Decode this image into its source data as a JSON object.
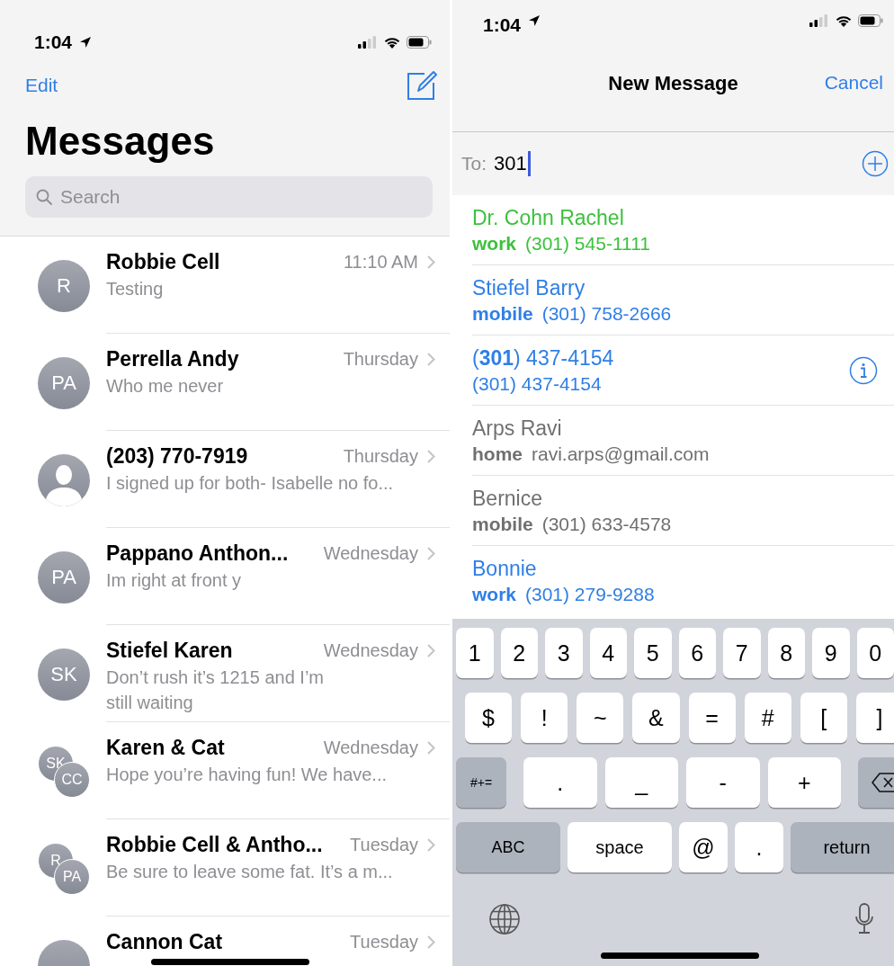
{
  "inbox": {
    "status_bar": {
      "time": "1:04"
    },
    "nav": {
      "edit": "Edit"
    },
    "title": "Messages",
    "search": {
      "placeholder": "Search"
    },
    "conversations": [
      {
        "name": "Robbie Cell",
        "time": "11:10 AM",
        "preview": "Testing",
        "avatar": {
          "kind": "initials",
          "initials": [
            "R"
          ]
        }
      },
      {
        "name": "Perrella Andy",
        "time": "Thursday",
        "preview": "Who me never",
        "avatar": {
          "kind": "initials",
          "initials": [
            "PA"
          ]
        }
      },
      {
        "name": "(203) 770-7919",
        "time": "Thursday",
        "preview": "I signed up for both- Isabelle no fo...",
        "avatar": {
          "kind": "silhouette"
        }
      },
      {
        "name": "Pappano Anthon...",
        "time": "Wednesday",
        "preview": "Im right at front y",
        "avatar": {
          "kind": "initials",
          "initials": [
            "PA"
          ]
        }
      },
      {
        "name": "Stiefel Karen",
        "time": "Wednesday",
        "preview": "Don’t rush it’s 1215 and I’m\nstill waiting",
        "avatar": {
          "kind": "initials",
          "initials": [
            "SK"
          ]
        }
      },
      {
        "name": "Karen & Cat",
        "time": "Wednesday",
        "preview": "Hope you’re having fun! We have...",
        "avatar": {
          "kind": "group",
          "initials": [
            "SK",
            "CC"
          ]
        }
      },
      {
        "name": "Robbie Cell & Antho...",
        "time": "Tuesday",
        "preview": "Be sure to leave some fat. It’s a m...",
        "avatar": {
          "kind": "group",
          "initials": [
            "R",
            "PA"
          ]
        }
      },
      {
        "name": "Cannon Cat",
        "time": "Tuesday",
        "avatar": {
          "kind": "blank"
        }
      }
    ]
  },
  "compose": {
    "status_bar": {
      "time": "1:04"
    },
    "nav": {
      "title": "New Message",
      "cancel": "Cancel"
    },
    "to_field": {
      "label": "To:",
      "value": "301"
    },
    "suggestions": [
      {
        "name": "Dr. Cohn Rachel",
        "label": "work",
        "detail": "(301) 545-1111",
        "color": "#3cc13c",
        "info": false
      },
      {
        "name": "Stiefel Barry",
        "label": "mobile",
        "detail": "(301) 758-2666",
        "color": "#2f7fe6",
        "info": false
      },
      {
        "name": "(**301**) 437-4154",
        "detail": "(301) 437-4154",
        "color": "#2f7fe6",
        "info": true
      },
      {
        "name": "Arps Ravi",
        "label": "home",
        "detail": "ravi.arps@gmail.com",
        "color": "#707070",
        "info": false
      },
      {
        "name": "Bernice",
        "label": "mobile",
        "detail": "(301) 633-4578",
        "color": "#707070",
        "info": false
      },
      {
        "name": "Bonnie",
        "label": "work",
        "detail": "(301) 279-9288",
        "color": "#2f7fe6",
        "info": false
      }
    ],
    "keyboard": {
      "rows": [
        {
          "keys": [
            {
              "kind": "char",
              "label": "1"
            },
            {
              "kind": "char",
              "label": "2"
            },
            {
              "kind": "char",
              "label": "3"
            },
            {
              "kind": "char",
              "label": "4"
            },
            {
              "kind": "char",
              "label": "5"
            },
            {
              "kind": "char",
              "label": "6"
            },
            {
              "kind": "char",
              "label": "7"
            },
            {
              "kind": "char",
              "label": "8"
            },
            {
              "kind": "char",
              "label": "9"
            },
            {
              "kind": "char",
              "label": "0"
            }
          ]
        },
        {
          "keys": [
            {
              "kind": "char",
              "label": "$"
            },
            {
              "kind": "char",
              "label": "!"
            },
            {
              "kind": "char",
              "label": "~"
            },
            {
              "kind": "char",
              "label": "&"
            },
            {
              "kind": "char",
              "label": "="
            },
            {
              "kind": "char",
              "label": "#"
            },
            {
              "kind": "char",
              "label": "["
            },
            {
              "kind": "char",
              "label": "]"
            }
          ]
        },
        {
          "keys": [
            {
              "kind": "function",
              "label": "#+="
            },
            {
              "kind": "char",
              "label": "."
            },
            {
              "kind": "char",
              "label": "_"
            },
            {
              "kind": "char",
              "label": "-"
            },
            {
              "kind": "char",
              "label": "+"
            },
            {
              "kind": "delete"
            }
          ]
        },
        {
          "keys": [
            {
              "kind": "function",
              "label": "ABC"
            },
            {
              "kind": "char",
              "label": "space"
            },
            {
              "kind": "char",
              "label": "@"
            },
            {
              "kind": "char",
              "label": "."
            },
            {
              "kind": "function",
              "label": "return"
            }
          ]
        }
      ]
    }
  }
}
